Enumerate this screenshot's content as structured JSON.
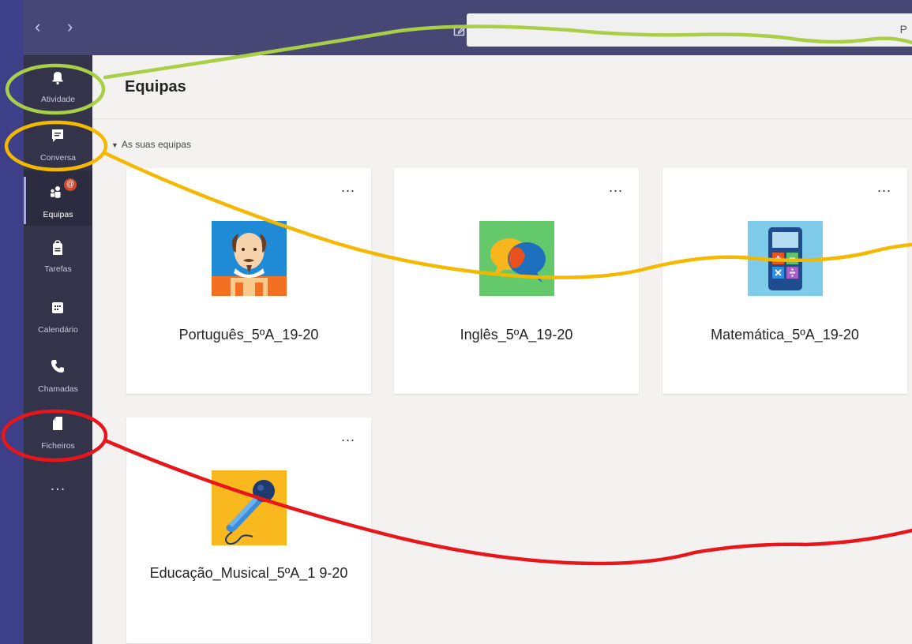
{
  "topbar": {
    "back_icon": "chevron-left-icon",
    "forward_icon": "chevron-right-icon",
    "compose_icon": "compose-icon",
    "search_hint": "P"
  },
  "rail": {
    "items": [
      {
        "label": "Atividade",
        "icon": "bell-icon"
      },
      {
        "label": "Conversa",
        "icon": "chat-icon"
      },
      {
        "label": "Equipas",
        "icon": "teams-icon",
        "active": true,
        "badge": "@"
      },
      {
        "label": "Tarefas",
        "icon": "assignments-icon"
      },
      {
        "label": "Calendário",
        "icon": "calendar-icon"
      },
      {
        "label": "Chamadas",
        "icon": "phone-icon"
      },
      {
        "label": "Ficheiros",
        "icon": "file-icon"
      }
    ],
    "more": "..."
  },
  "main": {
    "title": "Equipas",
    "section": "As suas equipas",
    "teams": [
      {
        "name": "Português_5ºA_19-20",
        "icon": "shakespeare-avatar",
        "more": "..."
      },
      {
        "name": "Inglês_5ºA_19-20",
        "icon": "speech-bubbles-avatar",
        "more": "..."
      },
      {
        "name": "Matemática_5ºA_19-20",
        "icon": "calculator-avatar",
        "more": "..."
      },
      {
        "name": "Educação_Musical_5ºA_1 9-20",
        "icon": "microphone-avatar",
        "more": "..."
      }
    ]
  },
  "colors": {
    "app_frame": "#3d4089",
    "topbar": "#464775",
    "rail": "#33344a",
    "main_bg": "#f3f2f1",
    "annotation_green": "#a8cf45",
    "annotation_yellow": "#f5b800",
    "annotation_red": "#e8161a"
  }
}
